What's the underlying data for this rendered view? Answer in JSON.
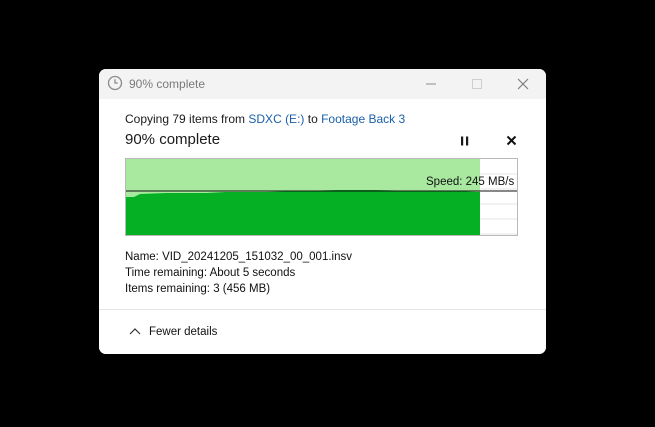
{
  "window": {
    "title": "90% complete"
  },
  "copy": {
    "prefix": "Copying 79 items from ",
    "source": "SDXC (E:)",
    "middle": " to ",
    "destination": "Footage Back 3",
    "status": "90% complete",
    "progress_fraction": 0.9
  },
  "graph": {
    "speed_text": "Speed: 245 MB/s",
    "fill_color": "#06b025",
    "area_color": "#a8e89f"
  },
  "details": {
    "name": "Name:  VID_20241205_151032_00_001.insv",
    "time_remaining": "Time remaining:  About 5 seconds",
    "items_remaining": "Items remaining:  3 (456 MB)"
  },
  "footer": {
    "toggle_label": "Fewer details"
  },
  "icons": [
    "clock-icon",
    "minimize-icon",
    "maximize-icon",
    "close-icon",
    "pause-icon",
    "stop-icon",
    "chevron-up-icon"
  ]
}
